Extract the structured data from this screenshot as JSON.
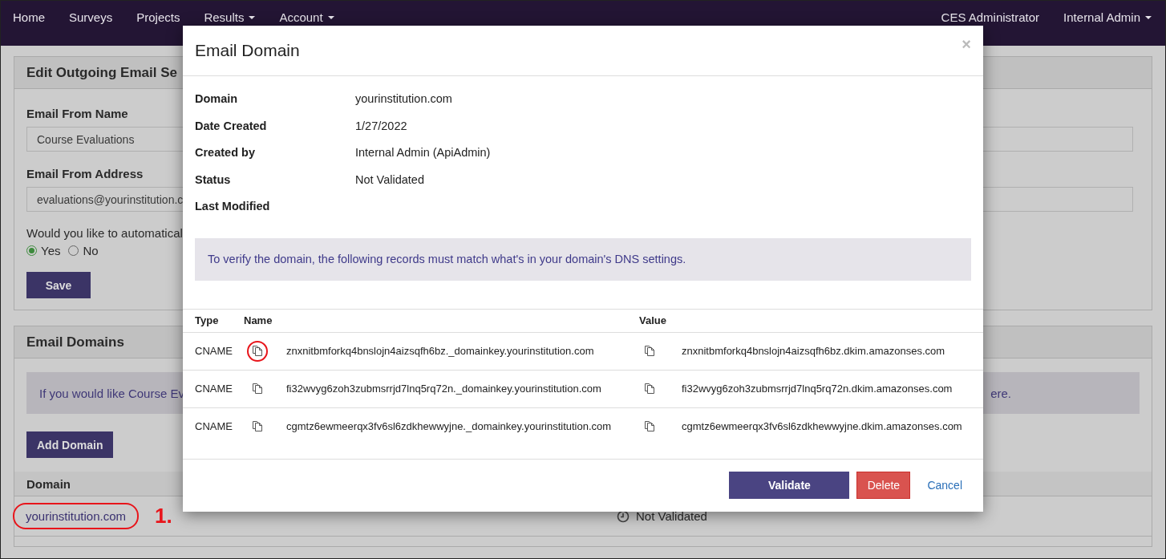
{
  "navbar": {
    "left_items": [
      {
        "label": "Home",
        "has_caret": false
      },
      {
        "label": "Surveys",
        "has_caret": false
      },
      {
        "label": "Projects",
        "has_caret": false
      },
      {
        "label": "Results",
        "has_caret": true
      },
      {
        "label": "Account",
        "has_caret": true
      }
    ],
    "right_items": [
      {
        "label": "CES Administrator",
        "has_caret": false
      },
      {
        "label": "Internal Admin",
        "has_caret": true
      }
    ]
  },
  "settings_panel": {
    "title": "Edit Outgoing Email Se",
    "fields": [
      {
        "label": "Email From Name",
        "value": "Course Evaluations"
      },
      {
        "label": "Email From Address",
        "value": "evaluations@yourinstitution.c"
      }
    ],
    "question": "Would you like to automatical",
    "options": [
      {
        "label": "Yes",
        "selected": true
      },
      {
        "label": "No",
        "selected": false
      }
    ],
    "save_button": "Save"
  },
  "domains_panel": {
    "title": "Email Domains",
    "alert_start": "If you would like Course Ev",
    "alert_end": "ere.",
    "add_button": "Add Domain",
    "table": {
      "columns": [
        "Domain"
      ],
      "rows": [
        {
          "domain": "yourinstitution.com",
          "status": "Not Validated",
          "circled": true,
          "callout": "1."
        }
      ]
    }
  },
  "modal": {
    "title": "Email Domain",
    "close": "×",
    "details": [
      {
        "label": "Domain",
        "value": "yourinstitution.com"
      },
      {
        "label": "Date Created",
        "value": "1/27/2022"
      },
      {
        "label": "Created by",
        "value": "Internal Admin (ApiAdmin)"
      },
      {
        "label": "Status",
        "value": "Not Validated"
      },
      {
        "label": "Last Modified"
      }
    ],
    "info": "To verify the domain, the following records must match what's in your domain's DNS settings.",
    "records": {
      "columns": [
        "Type",
        "Name",
        "Value"
      ],
      "rows": [
        {
          "type": "CNAME",
          "name": "znxnitbmforkq4bnslojn4aizsqfh6bz._domainkey.yourinstitution.com",
          "value": "znxnitbmforkq4bnslojn4aizsqfh6bz.dkim.amazonses.com",
          "name_copy_circled": true
        },
        {
          "type": "CNAME",
          "name": "fi32wvyg6zoh3zubmsrrjd7lnq5rq72n._domainkey.yourinstitution.com",
          "value": "fi32wvyg6zoh3zubmsrrjd7lnq5rq72n.dkim.amazonses.com",
          "name_copy_circled": false
        },
        {
          "type": "CNAME",
          "name": "cgmtz6ewmeerqx3fv6sl6zdkhewwyjne._domainkey.yourinstitution.com",
          "value": "cgmtz6ewmeerqx3fv6sl6zdkhewwyjne.dkim.amazonses.com",
          "name_copy_circled": false
        }
      ]
    },
    "buttons": [
      {
        "label": "Validate",
        "kind": "primary"
      },
      {
        "label": "Delete",
        "kind": "danger"
      },
      {
        "label": "Cancel",
        "kind": "link"
      }
    ]
  }
}
